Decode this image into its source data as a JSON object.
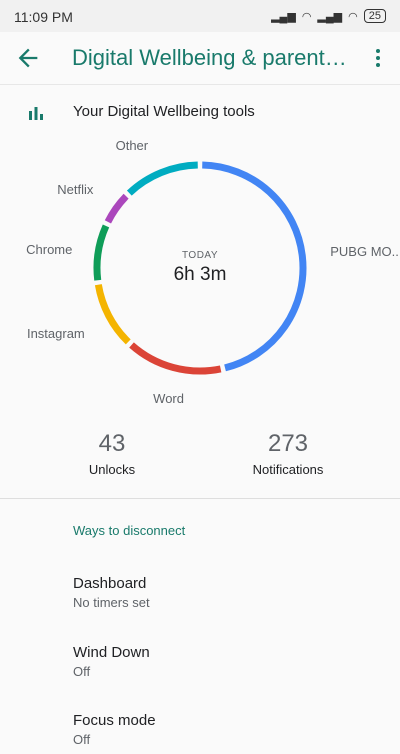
{
  "status": {
    "time": "11:09 PM",
    "battery": "25"
  },
  "appbar": {
    "title": "Digital Wellbeing & parental controls"
  },
  "tools": {
    "label": "Your Digital Wellbeing tools"
  },
  "usage": {
    "caption": "TODAY",
    "total": "6h 3m",
    "apps": [
      {
        "name": "PUBG MO...",
        "color": "#4285f4",
        "minutes": 150
      },
      {
        "name": "Word",
        "color": "#db4437",
        "minutes": 50
      },
      {
        "name": "Instagram",
        "color": "#f4b400",
        "minutes": 35
      },
      {
        "name": "Chrome",
        "color": "#0f9d58",
        "minutes": 30
      },
      {
        "name": "Netflix",
        "color": "#ab47bc",
        "minutes": 18
      },
      {
        "name": "Other",
        "color": "#00acc1",
        "minutes": 40
      }
    ]
  },
  "stats": {
    "unlocks_value": "43",
    "unlocks_label": "Unlocks",
    "notifications_value": "273",
    "notifications_label": "Notifications"
  },
  "section": {
    "title": "Ways to disconnect"
  },
  "items": [
    {
      "title": "Dashboard",
      "subtitle": "No timers set"
    },
    {
      "title": "Wind Down",
      "subtitle": "Off"
    },
    {
      "title": "Focus mode",
      "subtitle": "Off"
    }
  ],
  "colors": {
    "accent": "#197a6b"
  }
}
